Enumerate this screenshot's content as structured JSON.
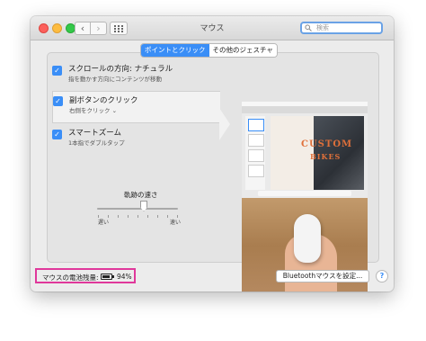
{
  "window": {
    "title": "マウス",
    "search_placeholder": "検索",
    "nav_back_glyph": "‹",
    "nav_forward_glyph": "›"
  },
  "tabs": [
    {
      "label": "ポイントとクリック",
      "active": true
    },
    {
      "label": "その他のジェスチャ",
      "active": false
    }
  ],
  "options": [
    {
      "label": "スクロールの方向: ナチュラル",
      "sublabel": "指を動かす方向にコンテンツが移動",
      "checked": true
    },
    {
      "label": "副ボタンのクリック",
      "sublabel": "右側をクリック ⌄",
      "checked": true,
      "selected": true
    },
    {
      "label": "スマートズーム",
      "sublabel": "1本指でダブルタップ",
      "checked": true
    }
  ],
  "tracking": {
    "label": "軌跡の速さ",
    "min_label": "遅い",
    "max_label": "速い",
    "level": 0.58
  },
  "preview": {
    "slide_title": "CUSTOM",
    "slide_subtitle": "BIKES"
  },
  "battery": {
    "label": "マウスの電池残量:",
    "percent_text": "94%",
    "level": 0.94,
    "highlight_color": "#e0389b"
  },
  "bluetooth_button": "Bluetoothマウスを設定...",
  "help_label": "?",
  "accent_color": "#3a8ef7"
}
